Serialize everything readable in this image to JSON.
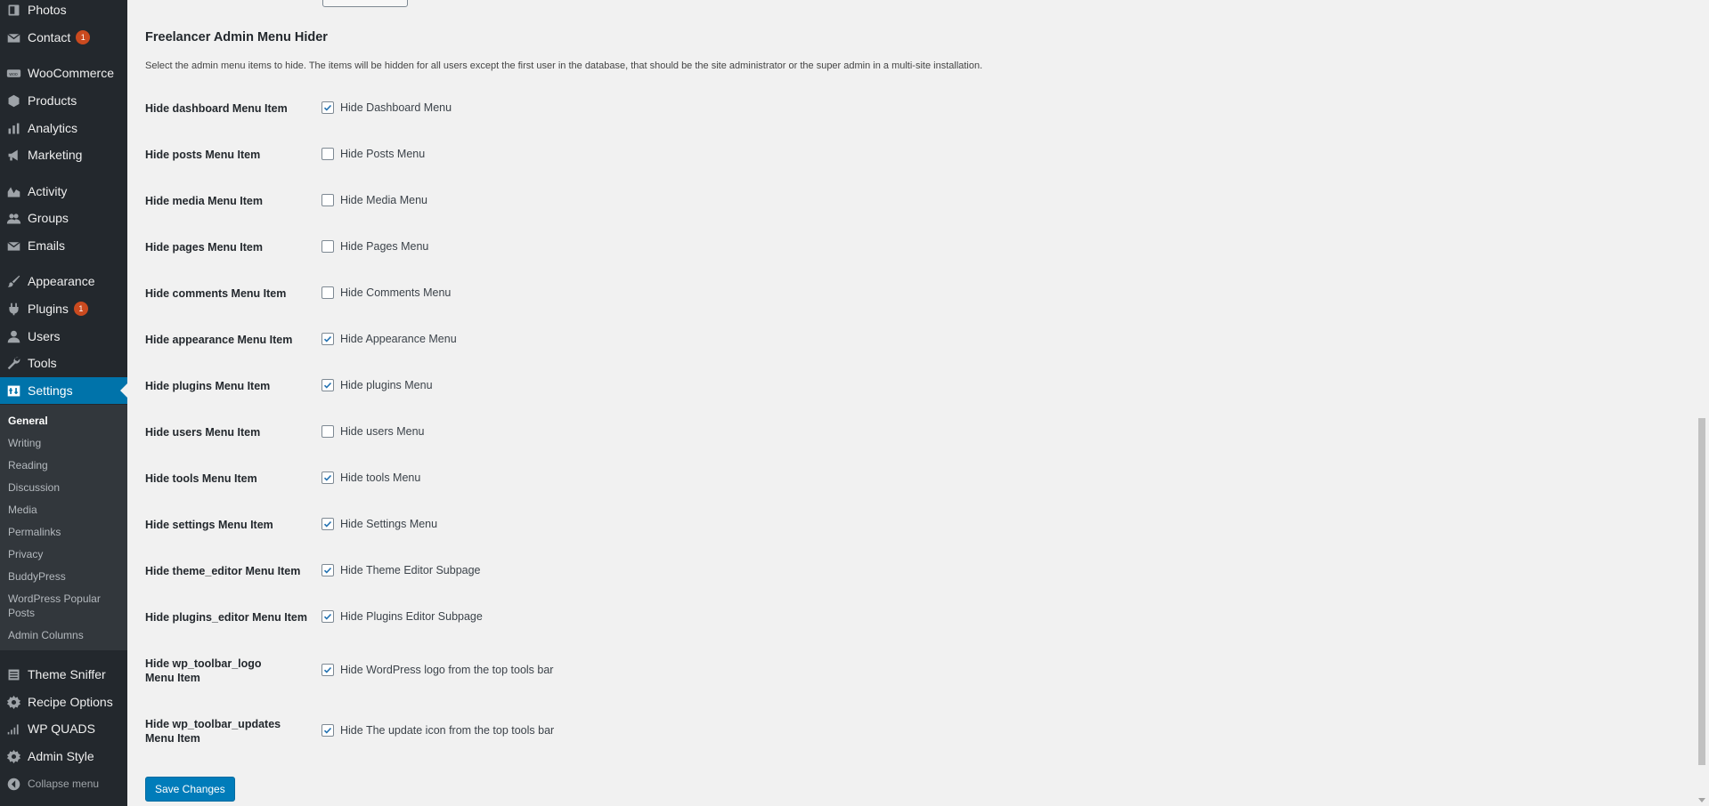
{
  "sidebar": {
    "items": [
      {
        "label": "Photos",
        "icon": "photos-icon"
      },
      {
        "label": "Contact",
        "icon": "mail-icon",
        "badge": "1"
      },
      {
        "label": "WooCommerce",
        "icon": "woocommerce-icon"
      },
      {
        "label": "Products",
        "icon": "products-icon"
      },
      {
        "label": "Analytics",
        "icon": "analytics-icon"
      },
      {
        "label": "Marketing",
        "icon": "megaphone-icon"
      },
      {
        "label": "Activity",
        "icon": "activity-icon"
      },
      {
        "label": "Groups",
        "icon": "groups-icon"
      },
      {
        "label": "Emails",
        "icon": "mail-icon"
      },
      {
        "label": "Appearance",
        "icon": "brush-icon"
      },
      {
        "label": "Plugins",
        "icon": "plugin-icon",
        "badge": "1"
      },
      {
        "label": "Users",
        "icon": "user-icon"
      },
      {
        "label": "Tools",
        "icon": "wrench-icon"
      },
      {
        "label": "Settings",
        "icon": "settings-icon"
      }
    ],
    "submenu": [
      "General",
      "Writing",
      "Reading",
      "Discussion",
      "Media",
      "Permalinks",
      "Privacy",
      "BuddyPress",
      "WordPress Popular Posts",
      "Admin Columns"
    ],
    "extra_items": [
      {
        "label": "Theme Sniffer",
        "icon": "theme-sniffer-icon"
      },
      {
        "label": "Recipe Options",
        "icon": "gear-icon"
      },
      {
        "label": "WP QUADS",
        "icon": "signal-icon"
      },
      {
        "label": "Admin Style",
        "icon": "gear-icon"
      }
    ],
    "collapse_label": "Collapse menu"
  },
  "main": {
    "title": "Freelancer Admin Menu Hider",
    "description": "Select the admin menu items to hide. The items will be hidden for all users except the first user in the database, that should be the site administrator or the super admin in a multi-site installation.",
    "rows": [
      {
        "label": "Hide dashboard Menu Item",
        "option": "Hide Dashboard Menu",
        "checked": true
      },
      {
        "label": "Hide posts Menu Item",
        "option": "Hide Posts Menu",
        "checked": false
      },
      {
        "label": "Hide media Menu Item",
        "option": "Hide Media Menu",
        "checked": false
      },
      {
        "label": "Hide pages Menu Item",
        "option": "Hide Pages Menu",
        "checked": false
      },
      {
        "label": "Hide comments Menu Item",
        "option": "Hide Comments Menu",
        "checked": false
      },
      {
        "label": "Hide appearance Menu Item",
        "option": "Hide Appearance Menu",
        "checked": true
      },
      {
        "label": "Hide plugins Menu Item",
        "option": "Hide plugins Menu",
        "checked": true
      },
      {
        "label": "Hide users Menu Item",
        "option": "Hide users Menu",
        "checked": false
      },
      {
        "label": "Hide tools Menu Item",
        "option": "Hide tools Menu",
        "checked": true
      },
      {
        "label": "Hide settings Menu Item",
        "option": "Hide Settings Menu",
        "checked": true
      },
      {
        "label": "Hide theme_editor Menu Item",
        "option": "Hide Theme Editor Subpage",
        "checked": true
      },
      {
        "label": "Hide plugins_editor Menu Item",
        "option": "Hide Plugins Editor Subpage",
        "checked": true
      },
      {
        "label": "Hide wp_toolbar_logo Menu Item",
        "option": "Hide WordPress logo from the top tools bar",
        "checked": true
      },
      {
        "label": "Hide wp_toolbar_updates Menu Item",
        "option": "Hide The update icon from the top tools bar",
        "checked": true
      }
    ],
    "save_label": "Save Changes"
  },
  "colors": {
    "sidebar_bg": "#23282d",
    "submenu_bg": "#32373c",
    "accent": "#0073aa",
    "badge": "#ca4a1f",
    "page_bg": "#f1f1f1"
  }
}
